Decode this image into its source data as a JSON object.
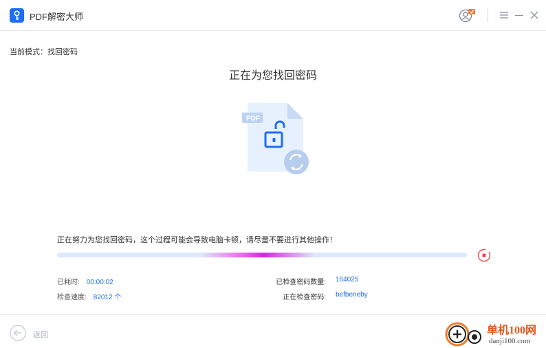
{
  "app": {
    "title": "PDF解密大师",
    "icons": [
      "key-logo-icon",
      "user-icon",
      "menu-icon",
      "minimize-icon",
      "close-icon"
    ]
  },
  "mode": {
    "label": "当前模式：找回密码"
  },
  "main": {
    "heading": "正在为您找回密码",
    "file_badge": "PDF",
    "illustration_icons": [
      "pdf-file-icon",
      "unlock-icon",
      "refresh-icon"
    ]
  },
  "progress": {
    "message": "正在努力为您找回密码，这个过程可能会导致电脑卡顿，请尽量不要进行其他操作！",
    "indeterminate": true,
    "stop_icon": "stop-icon"
  },
  "stats": {
    "elapsed_label": "已耗时:",
    "elapsed_value": "00:00:02",
    "speed_label": "检查速度:",
    "speed_value": "82012 个",
    "checked_label": "已检查密码数量:",
    "checked_value": "164025",
    "current_label": "正在检查密码:",
    "current_value": "befbeneby"
  },
  "footer": {
    "back_label": "返回"
  },
  "watermark": {
    "name": "单机100网",
    "url": "danji100.com"
  },
  "colors": {
    "accent": "#1f6df2",
    "progress_track": "#dbe9fb",
    "progress_glow": "#e23fe0",
    "stop": "#e84b4b",
    "watermark": "#e8571c"
  }
}
